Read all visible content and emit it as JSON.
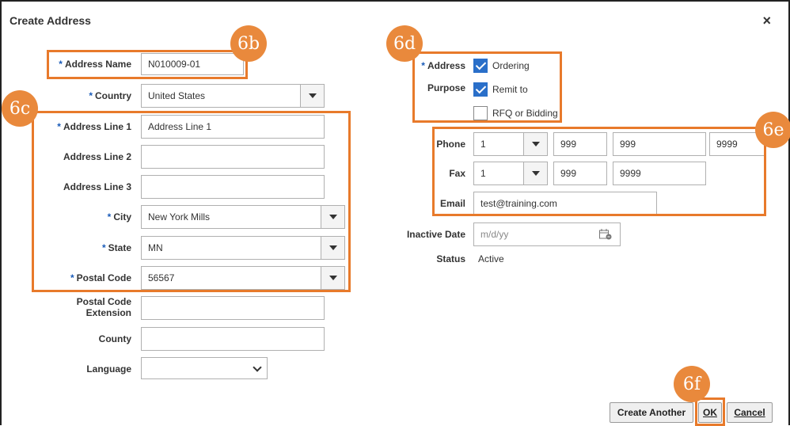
{
  "dialog": {
    "title": "Create Address",
    "close_glyph": "×"
  },
  "left": {
    "address_name": {
      "label": "Address Name",
      "value": "N010009-01",
      "required": true
    },
    "country": {
      "label": "Country",
      "value": "United States",
      "required": true
    },
    "address_line_1": {
      "label": "Address Line 1",
      "value": "Address Line 1",
      "required": true
    },
    "address_line_2": {
      "label": "Address Line 2",
      "value": ""
    },
    "address_line_3": {
      "label": "Address Line 3",
      "value": ""
    },
    "city": {
      "label": "City",
      "value": "New York Mills",
      "required": true
    },
    "state": {
      "label": "State",
      "value": "MN",
      "required": true
    },
    "postal_code": {
      "label": "Postal Code",
      "value": "56567",
      "required": true
    },
    "postal_code_extension": {
      "label_line1": "Postal Code",
      "label_line2": "Extension",
      "value": ""
    },
    "county": {
      "label": "County",
      "value": ""
    },
    "language": {
      "label": "Language",
      "value": ""
    }
  },
  "right": {
    "address_purpose": {
      "label_line1": "Address",
      "label_line2": "Purpose",
      "required": true,
      "options": [
        {
          "label": "Ordering",
          "checked": true
        },
        {
          "label": "Remit to",
          "checked": true
        },
        {
          "label": "RFQ or Bidding",
          "checked": false
        }
      ]
    },
    "phone": {
      "label": "Phone",
      "country_code": "1",
      "area": "999",
      "exchange": "999",
      "number": "9999"
    },
    "fax": {
      "label": "Fax",
      "country_code": "1",
      "area": "999",
      "number": "9999"
    },
    "email": {
      "label": "Email",
      "value": "test@training.com"
    },
    "inactive_date": {
      "label": "Inactive Date",
      "placeholder": "m/d/yy"
    },
    "status": {
      "label": "Status",
      "value": "Active"
    }
  },
  "buttons": {
    "create_another": "Create Another",
    "ok": "OK",
    "cancel": "Cancel"
  },
  "callouts": {
    "b": "6b",
    "c": "6c",
    "d": "6d",
    "e": "6e",
    "f": "6f"
  },
  "colors": {
    "callout": "#e87a2b",
    "required_star": "#1a5bb8",
    "checkbox": "#2a6fc9"
  },
  "required_mark": "*"
}
